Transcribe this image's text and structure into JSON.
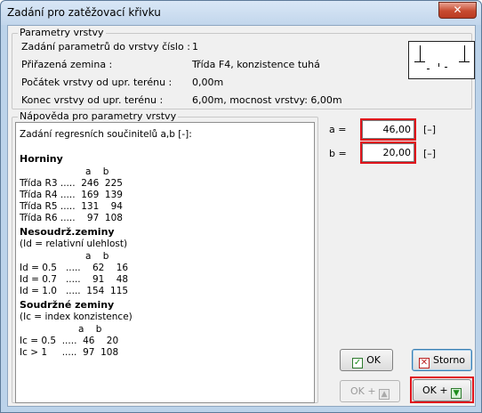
{
  "window": {
    "title": "Zadání pro zatěžovací křivku",
    "close_glyph": "✕"
  },
  "params": {
    "legend": "Parametry vrstvy",
    "rows": [
      {
        "label": "Zadání parametrů do vrstvy číslo :",
        "value": "1"
      },
      {
        "label": "Přiřazená zemina :",
        "value": "Třída F4, konzistence tuhá"
      },
      {
        "label": "Počátek vrstvy od upr. terénu :",
        "value": "0,00m"
      },
      {
        "label": "Konec vrstvy od upr. terénu :",
        "value": "6,00m, mocnost vrstvy: 6,00m"
      }
    ]
  },
  "help": {
    "legend": "Nápověda pro parametry vrstvy",
    "intro": "Zadání regresních součinitelů a,b [-]:",
    "horniny_head": "Horniny",
    "horniny_cols": "a    b",
    "horniny_rows": [
      "Třída R3 .....  246  225",
      "Třída R4 .....  169  139",
      "Třída R5 .....  131    94",
      "Třída R6 .....    97  108"
    ],
    "nesoudrz_head": "Nesoudrž.zeminy",
    "nesoudrz_note": "(Id = relativní ulehlost)",
    "nesoudrz_cols": "a    b",
    "nesoudrz_rows": [
      "Id = 0.5   .....    62    16",
      "Id = 0.7   .....    91    48",
      "Id = 1.0   .....  154  115"
    ],
    "soudrz_head": "Soudržné zeminy",
    "soudrz_note": "(Ic = index konzistence)",
    "soudrz_cols": "a    b",
    "soudrz_rows": [
      "Ic = 0.5  .....  46    20",
      "Ic > 1     .....  97  108"
    ]
  },
  "fields": {
    "a_label": "a =",
    "a_value": "46,00",
    "a_unit": "[–]",
    "b_label": "b =",
    "b_value": "20,00",
    "b_unit": "[–]"
  },
  "buttons": {
    "ok": "OK",
    "storno": "Storno",
    "ok_plus_disabled": "OK +",
    "ok_plus": "OK +"
  },
  "colors": {
    "highlight_red": "#e0141b",
    "title_bar": "#c2d6ec"
  }
}
